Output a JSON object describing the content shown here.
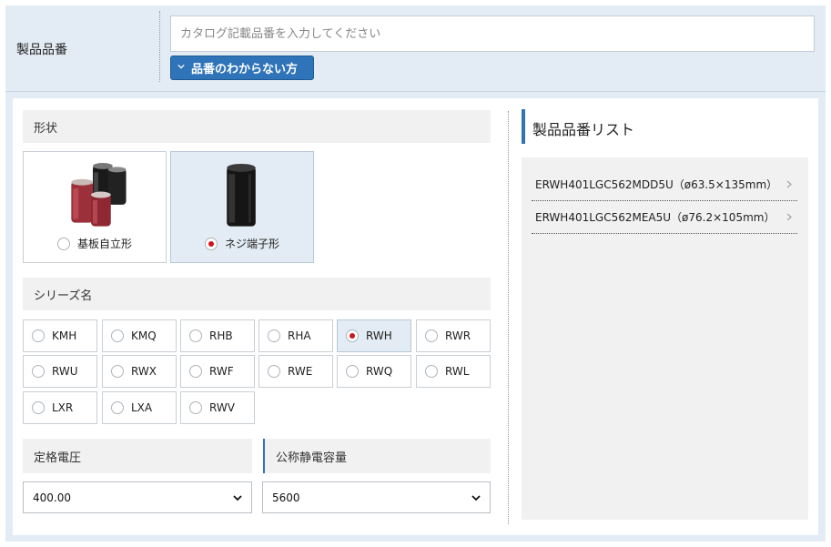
{
  "header": {
    "label": "製品品番",
    "search_placeholder": "カタログ記載品番を入力してください",
    "search_value": "",
    "unknown_button": "品番のわからない方"
  },
  "shape": {
    "heading": "形状",
    "options": [
      {
        "label": "基板自立形",
        "selected": false
      },
      {
        "label": "ネジ端子形",
        "selected": true
      }
    ]
  },
  "series": {
    "heading": "シリーズ名",
    "options": [
      {
        "label": "KMH",
        "selected": false
      },
      {
        "label": "KMQ",
        "selected": false
      },
      {
        "label": "RHB",
        "selected": false
      },
      {
        "label": "RHA",
        "selected": false
      },
      {
        "label": "RWH",
        "selected": true
      },
      {
        "label": "RWR",
        "selected": false
      },
      {
        "label": "RWU",
        "selected": false
      },
      {
        "label": "RWX",
        "selected": false
      },
      {
        "label": "RWF",
        "selected": false
      },
      {
        "label": "RWE",
        "selected": false
      },
      {
        "label": "RWQ",
        "selected": false
      },
      {
        "label": "RWL",
        "selected": false
      },
      {
        "label": "LXR",
        "selected": false
      },
      {
        "label": "LXA",
        "selected": false
      },
      {
        "label": "RWV",
        "selected": false
      }
    ]
  },
  "voltage": {
    "heading": "定格電圧",
    "selected": "400.00"
  },
  "capacitance": {
    "heading": "公称静電容量",
    "selected": "5600"
  },
  "product_list": {
    "title": "製品品番リスト",
    "items": [
      "ERWH401LGC562MDD5U（ø63.5×135mm）",
      "ERWH401LGC562MEA5U（ø76.2×105mm）"
    ]
  },
  "colors": {
    "accent": "#2f74b8",
    "radio_selected": "#d0141b",
    "band_bg": "#e3ecf4",
    "section_bg": "#f1f1f1"
  }
}
